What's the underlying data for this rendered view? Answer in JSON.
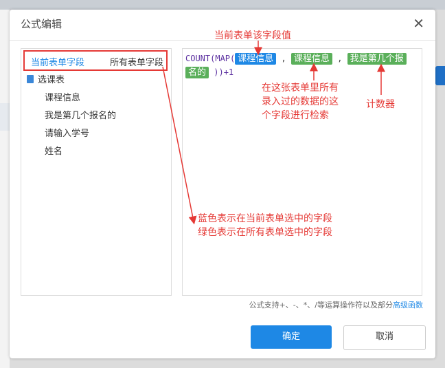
{
  "dialog": {
    "title": "公式编辑",
    "close_icon": "close-icon"
  },
  "left_panel": {
    "tabs": {
      "current": "当前表单字段",
      "all": "所有表单字段"
    },
    "tree_root": "选课表",
    "fields": [
      "课程信息",
      "我是第几个报名的",
      "请输入学号",
      "姓名"
    ]
  },
  "editor": {
    "line1_prefix": "COUNT(MAP(",
    "chip_blue": "课程信息",
    "sep1": ",",
    "chip_green1": "课程信息",
    "sep2": ",",
    "chip_green2_part1": "我是第几个报",
    "chip_green2_part2": "名的",
    "line2_suffix": "))+1"
  },
  "annotations": {
    "top": "当前表单该字段值",
    "middle_l1": "在这张表单里所有",
    "middle_l2": "录入过的数据的这",
    "middle_l3": "个字段进行检索",
    "right": "计数器",
    "legend_l1": "蓝色表示在当前表单选中的字段",
    "legend_l2": "绿色表示在所有表单选中的字段",
    "color": "#e53935"
  },
  "hint": {
    "text": "公式支持+、-、*、/等运算操作符以及部分",
    "link": "高级函数"
  },
  "buttons": {
    "ok": "确定",
    "cancel": "取消"
  },
  "colors": {
    "primary": "#1e88e5",
    "green_chip": "#5aaf5a"
  }
}
